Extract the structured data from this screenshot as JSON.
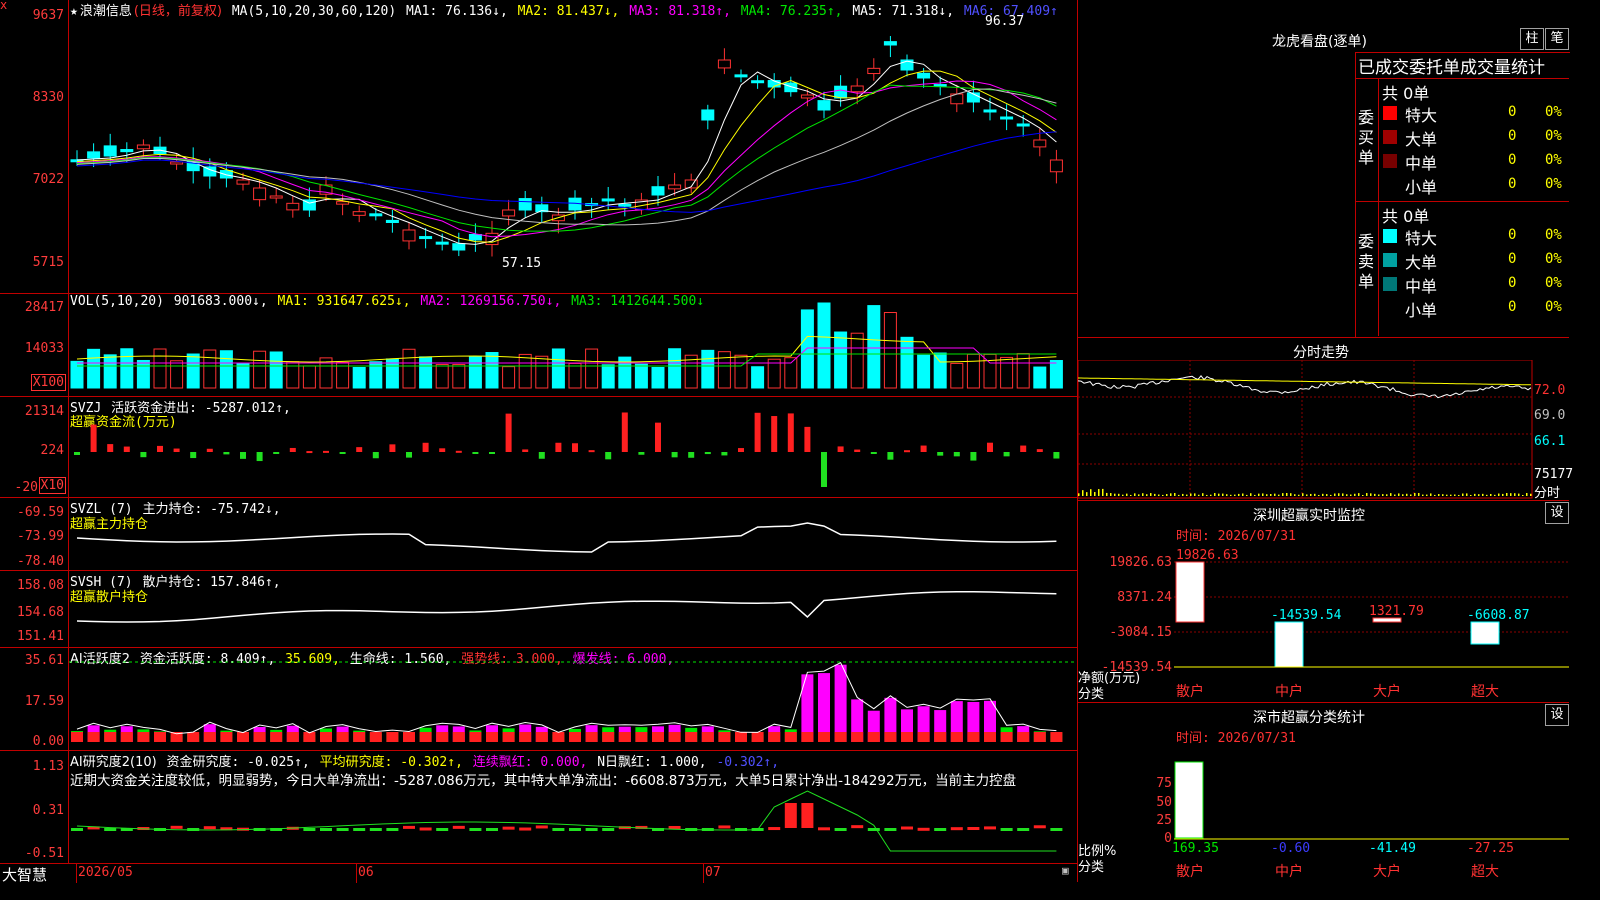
{
  "main_chart": {
    "close_btn": "x",
    "stock_name": "浪潮信息",
    "period": "(日线，前复权)",
    "ma_header": "MA(5,10,20,30,60,120)",
    "ma1": "MA1: 76.136↓,",
    "ma2": "MA2: 81.437↓,",
    "ma3": "MA3: 81.318↑,",
    "ma4": "MA4: 76.235↑,",
    "ma5": "MA5: 71.318↓,",
    "ma6": "MA6: 67.409↑",
    "y_labels": [
      "9637",
      "8330",
      "7022",
      "5715"
    ],
    "high_label": "96.37",
    "low_label": "57.15"
  },
  "volume": {
    "title": "VOL(5,10,20)",
    "value": "901683.000↓,",
    "ma1": "MA1: 931647.625↓,",
    "ma2": "MA2: 1269156.750↓,",
    "ma3": "MA3: 1412644.500↓",
    "y_labels": [
      "28417",
      "14033"
    ],
    "unit": "X100"
  },
  "svzj": {
    "title": "SVZJ",
    "text": "活跃资金进出: -5287.012↑,",
    "subtitle": "超赢资金流(万元)",
    "y_labels": [
      "21314",
      "224",
      "-20"
    ],
    "unit": "X10"
  },
  "svzl": {
    "title": "SVZL (7)",
    "text": "主力持仓: -75.742↓,",
    "subtitle": "超赢主力持仓",
    "y_labels": [
      "-69.59",
      "-73.99",
      "-78.40"
    ]
  },
  "svsh": {
    "title": "SVSH (7)",
    "text": "散户持仓: 157.846↑,",
    "subtitle": "超赢散户持仓",
    "y_labels": [
      "158.08",
      "154.68",
      "151.41"
    ]
  },
  "ai1": {
    "title": "AI活跃度2",
    "text1": "资金活跃度: 8.409↑,",
    "text2": "35.609,",
    "text3": "生命线: 1.560,",
    "text4": "强势线: 3.000,",
    "text5": "爆发线: 6.000,",
    "y_labels": [
      "35.61",
      "17.59",
      "0.00"
    ]
  },
  "ai2": {
    "title": "AI研究度2(10)",
    "text1": "资金研究度: -0.025↑,",
    "text2": "平均研究度: -0.302↑,",
    "text3": "连续飘红: 0.000,",
    "text4": "N日飘红: 1.000,",
    "text5": "-0.302↑,",
    "comment": "近期大资金关注度较低，明显弱势，今日大单净流出：-5287.086万元，其中特大单净流出：-6608.873万元，大单5日累计净出-184292万元，当前主力控盘",
    "y_labels": [
      "1.13",
      "0.31",
      "-0.51"
    ]
  },
  "bottom": {
    "brand": "大智慧",
    "dates": [
      "2026/05",
      "06",
      "07"
    ]
  },
  "right": {
    "title": "龙虎看盘(逐单)",
    "btn_bar": "柱",
    "btn_pen": "笔",
    "tabs": [
      "已成交",
      "委托单",
      "成交量统计"
    ],
    "buy_label": "委买单",
    "sell_label": "委卖单",
    "buy_total": "共 0单",
    "sell_total": "共 0单",
    "buy_rows": [
      {
        "name": "特大",
        "count": "0",
        "pct": "0%",
        "color": "#ff0000"
      },
      {
        "name": "大单",
        "count": "0",
        "pct": "0%",
        "color": "#a00000"
      },
      {
        "name": "中单",
        "count": "0",
        "pct": "0%",
        "color": "#780000"
      },
      {
        "name": "小单",
        "count": "0",
        "pct": "0%",
        "color": ""
      }
    ],
    "sell_rows": [
      {
        "name": "特大",
        "count": "0",
        "pct": "0%",
        "color": "#00ffff"
      },
      {
        "name": "大单",
        "count": "0",
        "pct": "0%",
        "color": "#00a0a0"
      },
      {
        "name": "中单",
        "count": "0",
        "pct": "0%",
        "color": "#007878"
      },
      {
        "name": "小单",
        "count": "0",
        "pct": "0%",
        "color": ""
      }
    ],
    "intraday_title": "分时走势",
    "intraday_labels": [
      "72.0",
      "69.0",
      "66.1",
      "75177",
      "分时"
    ],
    "sz_title": "深圳超赢实时监控",
    "sz_settings": "设",
    "sz_time": "时间: 2026/07/31",
    "sz_y_labels": [
      "19826.63",
      "8371.24",
      "-3084.15",
      "-14539.54"
    ],
    "sz_values": [
      "19826.63",
      "-14539.54",
      "1321.79",
      "-6608.87"
    ],
    "sz_axis": "净额(万元)",
    "sz_axis2": "分类",
    "sz_categories": [
      "散户",
      "中户",
      "大户",
      "超大"
    ],
    "cls_title": "深市超赢分类统计",
    "cls_settings": "设",
    "cls_time": "时间: 2026/07/31",
    "cls_y_labels": [
      "75",
      "50",
      "25",
      "0"
    ],
    "cls_values": [
      "169.35",
      "-0.60",
      "-41.49",
      "-27.25"
    ],
    "cls_axis": "比例%",
    "cls_axis2": "分类",
    "cls_categories": [
      "散户",
      "中户",
      "大户",
      "超大"
    ]
  }
}
